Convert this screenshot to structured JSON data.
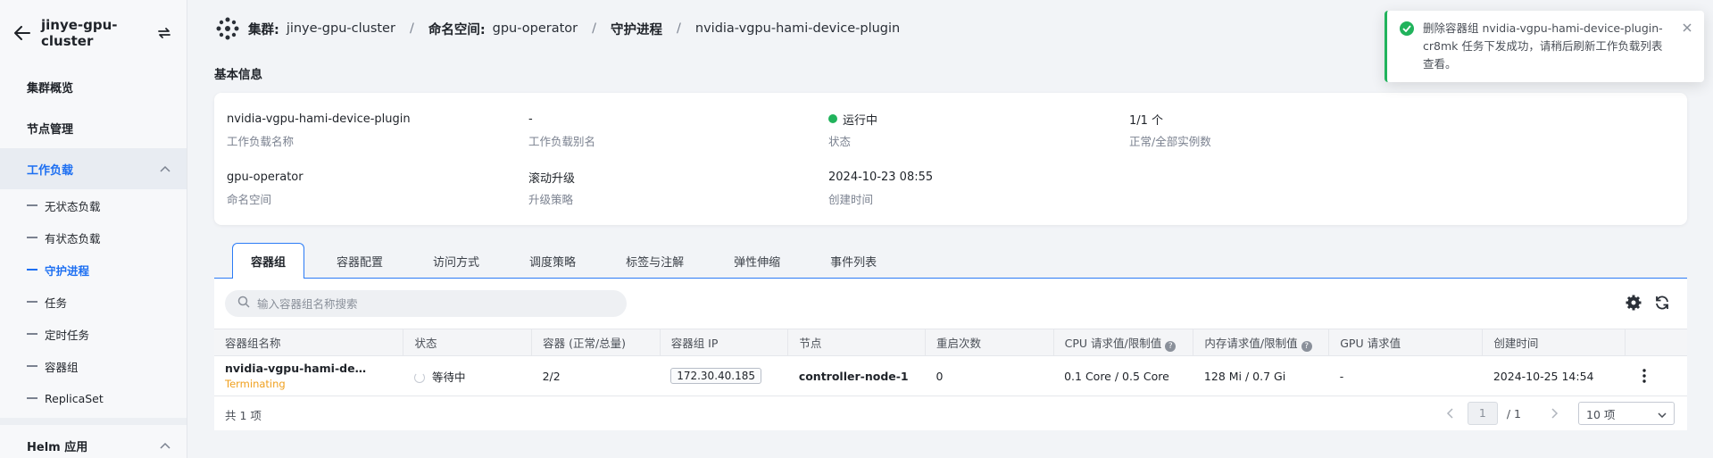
{
  "sidebar": {
    "cluster_name": "jinye-gpu-cluster",
    "items": {
      "overview": "集群概览",
      "nodes": "节点管理",
      "workloads": "工作负载",
      "helm": "Helm 应用"
    },
    "workload_sub": [
      "无状态负载",
      "有状态负载",
      "守护进程",
      "任务",
      "定时任务",
      "容器组",
      "ReplicaSet"
    ]
  },
  "breadcrumb": {
    "cluster_key": "集群:",
    "cluster_val": "jinye-gpu-cluster",
    "ns_key": "命名空间:",
    "ns_val": "gpu-operator",
    "kind": "守护进程",
    "name": "nvidia-vgpu-hami-device-plugin",
    "sep": "/"
  },
  "basic_info": {
    "title": "基本信息",
    "workload_name": "nvidia-vgpu-hami-device-plugin",
    "workload_name_label": "工作负载名称",
    "alias": "-",
    "alias_label": "工作负载别名",
    "status": "运行中",
    "status_label": "状态",
    "replicas": "1/1 个",
    "replicas_label": "正常/全部实例数",
    "namespace": "gpu-operator",
    "namespace_label": "命名空间",
    "strategy": "滚动升级",
    "strategy_label": "升级策略",
    "created": "2024-10-23 08:55",
    "created_label": "创建时间"
  },
  "tabs": [
    "容器组",
    "容器配置",
    "访问方式",
    "调度策略",
    "标签与注解",
    "弹性伸缩",
    "事件列表"
  ],
  "table": {
    "search_placeholder": "输入容器组名称搜索",
    "headers": {
      "name": "容器组名称",
      "status": "状态",
      "containers": "容器 (正常/总量)",
      "ip": "容器组 IP",
      "node": "节点",
      "restarts": "重启次数",
      "cpu": "CPU 请求值/限制值",
      "mem": "内存请求值/限制值",
      "gpu": "GPU 请求值",
      "created": "创建时间"
    },
    "rows": [
      {
        "name": "nvidia-vgpu-hami-device...",
        "sub": "Terminating",
        "status": "等待中",
        "containers": "2/2",
        "ip": "172.30.40.185",
        "node": "controller-node-1",
        "restarts": "0",
        "cpu": "0.1 Core / 0.5 Core",
        "mem": "128 Mi / 0.7 Gi",
        "gpu": "-",
        "created": "2024-10-25 14:54"
      }
    ],
    "total": "共 1 项",
    "page_current": "1",
    "page_total": "/ 1",
    "page_size": "10 项"
  },
  "toast": {
    "message": "删除容器组 nvidia-vgpu-hami-device-plugin-cr8mk 任务下发成功，请稍后刷新工作负载列表查看。"
  },
  "colors": {
    "accent": "#1d6ff2",
    "success": "#21b35c",
    "warning": "#f0a01e"
  }
}
